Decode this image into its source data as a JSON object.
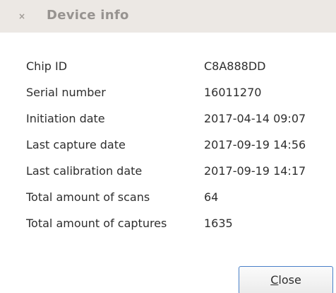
{
  "window": {
    "title": "Device info",
    "close_glyph": "×"
  },
  "info": {
    "rows": [
      {
        "label": "Chip ID",
        "value": "C8A888DD"
      },
      {
        "label": "Serial number",
        "value": "16011270"
      },
      {
        "label": "Initiation date",
        "value": "2017-04-14 09:07"
      },
      {
        "label": "Last capture date",
        "value": "2017-09-19 14:56"
      },
      {
        "label": "Last calibration date",
        "value": "2017-09-19 14:17"
      },
      {
        "label": "Total amount of scans",
        "value": "64"
      },
      {
        "label": "Total amount of captures",
        "value": "1635"
      }
    ]
  },
  "buttons": {
    "close_mnemonic": "C",
    "close_rest": "lose"
  }
}
